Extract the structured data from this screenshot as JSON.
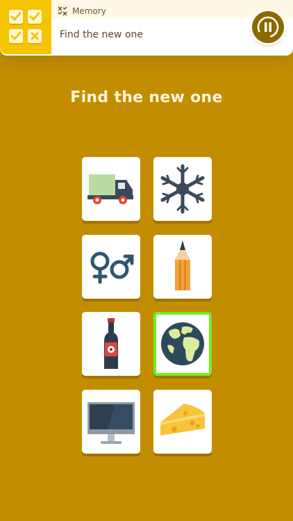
{
  "header": {
    "app_name": "Memory",
    "subtitle": "Find the new one",
    "logo_icon": "checkbox-grid-icon",
    "app_icon": "memory-app-icon",
    "pause_icon": "pause-icon"
  },
  "main": {
    "heading": "Find the new one",
    "cards": [
      {
        "icon": "truck",
        "selected": false
      },
      {
        "icon": "snowflake",
        "selected": false
      },
      {
        "icon": "gender-symbols",
        "selected": false
      },
      {
        "icon": "pencil",
        "selected": false
      },
      {
        "icon": "wine-bottle",
        "selected": false
      },
      {
        "icon": "globe",
        "selected": true
      },
      {
        "icon": "computer-monitor",
        "selected": false
      },
      {
        "icon": "cheese",
        "selected": false
      }
    ]
  },
  "colors": {
    "background": "#C28E00",
    "logo_tile": "#F6C400",
    "selected_border": "#6EF01A",
    "pause_button": "#8B6A00"
  }
}
